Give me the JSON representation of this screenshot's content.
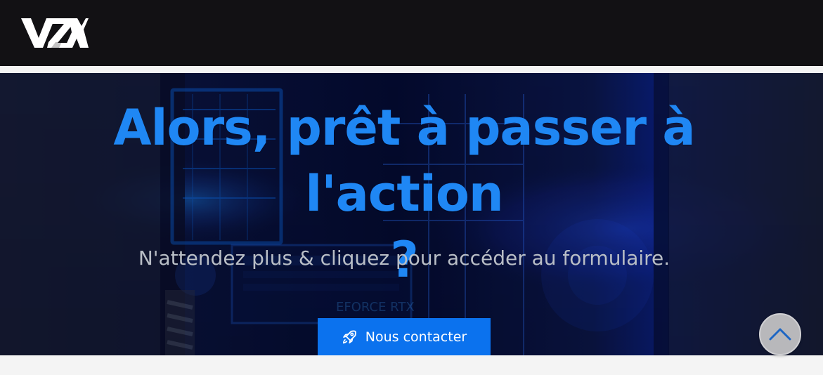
{
  "header": {
    "logo_text": "VZX"
  },
  "hero": {
    "title_line_1": "Alors, prêt à passer à l'action",
    "title_line_2": "?",
    "subtitle": "N'attendez plus & cliquez pour accéder au formulaire.",
    "button_label": "Nous contacter",
    "button_icon": "rocket-icon",
    "background_icon": "gaming-pc-background"
  },
  "scroll_top": {
    "icon": "chevron-up-icon"
  },
  "colors": {
    "header_bg": "#121114",
    "hero_bg": "#07103a",
    "title": "#1f87f4",
    "subtitle": "#b9bec6",
    "button": "#0b72ee",
    "scroll_button": "#b8b8bb",
    "scroll_chevron": "#1d66c4"
  }
}
